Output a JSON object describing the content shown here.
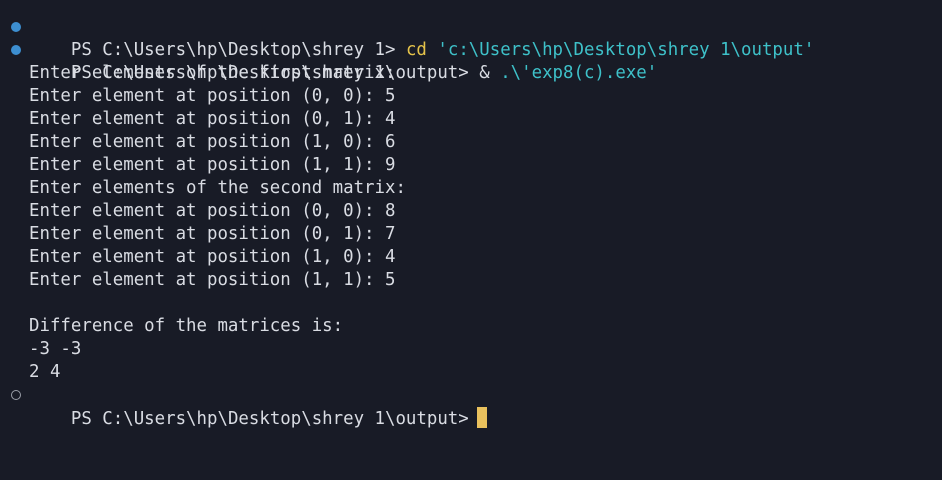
{
  "terminal": {
    "prompt1": {
      "prompt": "PS C:\\Users\\hp\\Desktop\\shrey 1> ",
      "command": "cd",
      "argument": "'c:\\Users\\hp\\Desktop\\shrey 1\\output'"
    },
    "prompt2": {
      "prompt": "PS C:\\Users\\hp\\Desktop\\shrey 1\\output> ",
      "operator": "& ",
      "argument": ".\\'exp8(c).exe'"
    },
    "output": [
      "Enter elements of the first matrix:",
      "Enter element at position (0, 0): 5",
      "Enter element at position (0, 1): 4",
      "Enter element at position (1, 0): 6",
      "Enter element at position (1, 1): 9",
      "Enter elements of the second matrix:",
      "Enter element at position (0, 0): 8",
      "Enter element at position (0, 1): 7",
      "Enter element at position (1, 0): 4",
      "Enter element at position (1, 1): 5",
      "",
      "Difference of the matrices is:",
      "-3 -3",
      "2 4"
    ],
    "prompt3": {
      "prompt": "PS C:\\Users\\hp\\Desktop\\shrey 1\\output>"
    },
    "colors": {
      "background": "#181b26",
      "text": "#d9dce3",
      "command": "#e5c34a",
      "string": "#3ec1c9",
      "decoration_success": "#3d8fd1",
      "cursor": "#e9c15d"
    }
  }
}
